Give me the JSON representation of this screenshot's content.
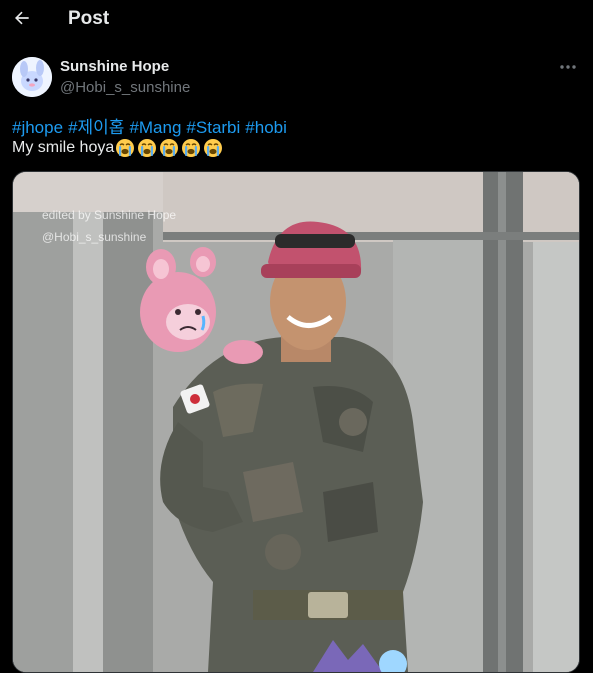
{
  "header": {
    "title": "Post"
  },
  "author": {
    "display_name": "Sunshine Hope",
    "handle": "@Hobi_s_sunshine"
  },
  "post": {
    "hashtags": [
      "#jhope",
      "#제이홉",
      "#Mang",
      "#Starbi",
      "#hobi"
    ],
    "text": "My smile hoya",
    "emoji_count": 5,
    "emoji_name": "loudly-crying-face"
  },
  "media": {
    "watermark_line1": "edited by Sunshine Hope",
    "watermark_line2": "@Hobi_s_sunshine"
  },
  "colors": {
    "background": "#000000",
    "text": "#e7e9ea",
    "muted": "#71767b",
    "link": "#1d9bf0"
  }
}
